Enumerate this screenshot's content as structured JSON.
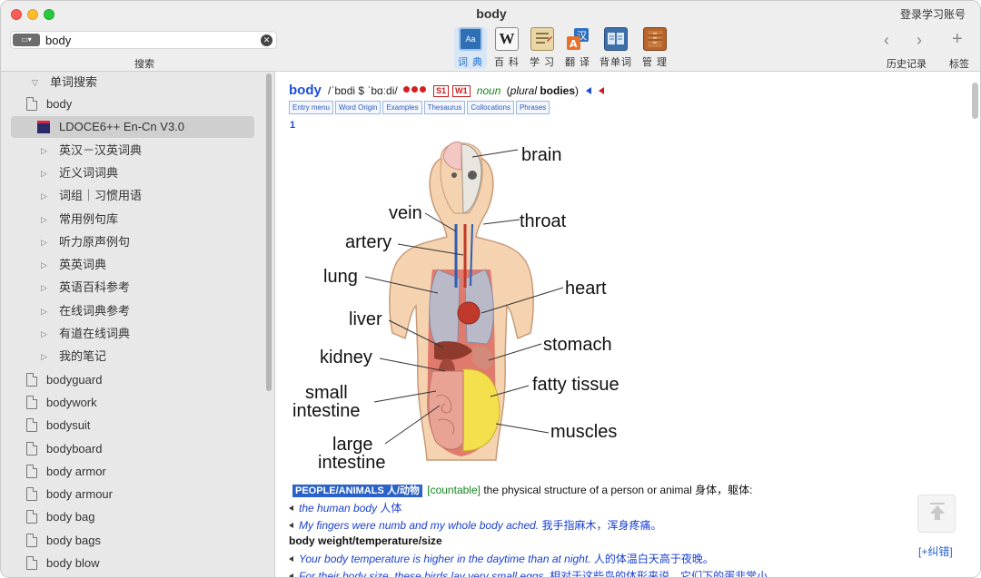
{
  "window": {
    "title": "body",
    "login_label": "登录学习账号"
  },
  "search": {
    "mode_icon": "dict-mode-icon",
    "value": "body",
    "label": "搜索"
  },
  "toolbar": {
    "tools": [
      {
        "label": "词 典",
        "icon": "dictionary-icon",
        "active": true
      },
      {
        "label": "百 科",
        "icon": "wikipedia-icon"
      },
      {
        "label": "学 习",
        "icon": "study-icon"
      },
      {
        "label": "翻 译",
        "icon": "translate-icon"
      },
      {
        "label": "背单词",
        "icon": "vocabulary-icon"
      },
      {
        "label": "管 理",
        "icon": "manage-icon"
      }
    ],
    "history_label": "历史记录",
    "bookmark_label": "标签",
    "bookmark_symbol": "+",
    "back_symbol": "‹",
    "forward_symbol": "›"
  },
  "sidebar": {
    "section_title": "单词搜索",
    "items": [
      {
        "label": "body",
        "type": "file"
      },
      {
        "label": "LDOCE6++ En-Cn V3.0",
        "type": "book",
        "selected": true
      },
      {
        "label": "英汉－汉英词典",
        "type": "group"
      },
      {
        "label": "近义词词典",
        "type": "group"
      },
      {
        "label": "词组｜习惯用语",
        "type": "group"
      },
      {
        "label": "常用例句库",
        "type": "group"
      },
      {
        "label": "听力原声例句",
        "type": "group"
      },
      {
        "label": "英英词典",
        "type": "group"
      },
      {
        "label": "英语百科参考",
        "type": "group"
      },
      {
        "label": "在线词典参考",
        "type": "group"
      },
      {
        "label": "有道在线词典",
        "type": "group"
      },
      {
        "label": "我的笔记",
        "type": "group"
      },
      {
        "label": "bodyguard",
        "type": "file"
      },
      {
        "label": "bodywork",
        "type": "file"
      },
      {
        "label": "bodysuit",
        "type": "file"
      },
      {
        "label": "bodyboard",
        "type": "file"
      },
      {
        "label": "body armor",
        "type": "file"
      },
      {
        "label": "body armour",
        "type": "file"
      },
      {
        "label": "body bag",
        "type": "file"
      },
      {
        "label": "body bags",
        "type": "file"
      },
      {
        "label": "body blow",
        "type": "file"
      }
    ]
  },
  "entry": {
    "headword": "body",
    "pronunciation": "/ˈbɒdi $ ˈbɑːdi/",
    "frequency_dots": 3,
    "badges": [
      "S1",
      "W1"
    ],
    "pos": "noun",
    "plural_label": "plural",
    "plural_form": "bodies",
    "tabs": [
      "Entry menu",
      "Word Origin",
      "Examples",
      "Thesaurus",
      "Collocations",
      "Phrases"
    ],
    "sense_number": "1",
    "illustration": {
      "labels": {
        "brain": "brain",
        "vein": "vein",
        "throat": "throat",
        "artery": "artery",
        "lung": "lung",
        "heart": "heart",
        "liver": "liver",
        "stomach": "stomach",
        "kidney": "kidney",
        "fatty_tissue": "fatty tissue",
        "small_intestine_1": "small",
        "small_intestine_2": "intestine",
        "muscles": "muscles",
        "large_intestine_1": "large",
        "large_intestine_2": "intestine"
      }
    },
    "definition": {
      "topic": "PEOPLE/ANIMALS 人/动物",
      "grammar": "[countable]",
      "text": "the physical structure of a person or animal",
      "cn": "身体，躯体:"
    },
    "examples": [
      {
        "en": "the human body",
        "cn": "人体"
      },
      {
        "en": "My fingers were numb and my whole body ached.",
        "cn": "我手指麻木，浑身疼痛。"
      }
    ],
    "phrase": "body weight/temperature/size",
    "phrase_examples": [
      {
        "en": "Your body temperature is higher in the daytime than at night.",
        "cn": "人的体温白天高于夜晚。"
      },
      {
        "en": "For their body size, these birds lay very small eggs.",
        "cn": "相对于这些鸟的体形来说，它们下的蛋非常小。"
      }
    ],
    "correct_link": "[+纠错]"
  }
}
